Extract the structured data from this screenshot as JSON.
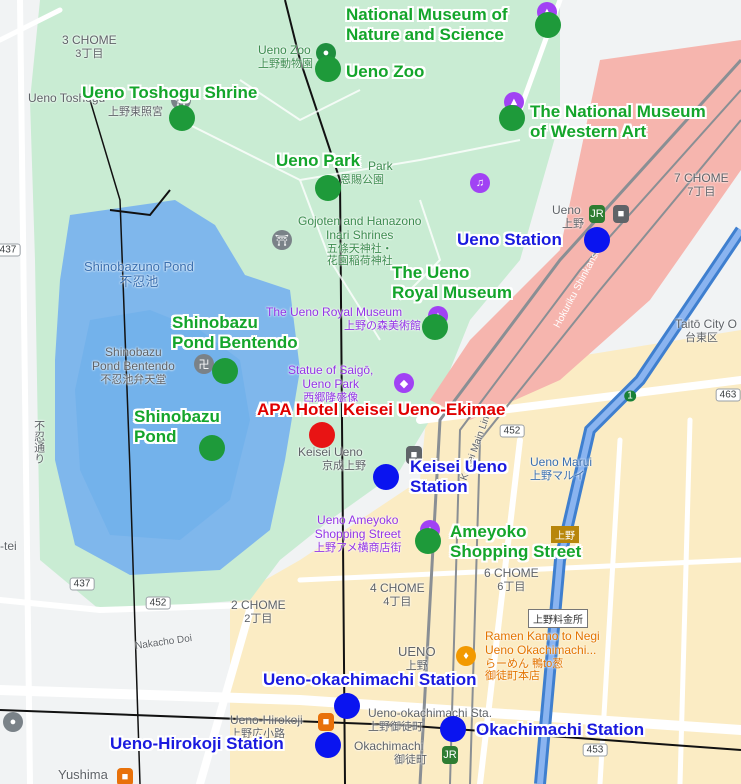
{
  "map": {
    "base_labels": {
      "chome3": {
        "text": "3 CHOME",
        "jp": "3丁目"
      },
      "ueno_zoo_small": {
        "text": "Ueno Zoo",
        "jp": "上野動物園"
      },
      "ueno_toshogu_small": {
        "text": "Ueno Toshogu",
        "jp": "上野東照宮"
      },
      "park_small": {
        "text": "Park",
        "jp": "恩賜公園"
      },
      "gojoten": {
        "text": "Gojoten and Hanazono",
        "text2": "Inari Shrines",
        "jp": "五條天神社・",
        "jp2": "花園稲荷神社"
      },
      "shinobazuno_pond": {
        "text": "Shinobazuno Pond",
        "jp": "不忍池"
      },
      "shinobazu_bentendo_small": {
        "text": "Shinobazu",
        "text2": "Pond Bentendo",
        "jp": "不忍池弁天堂"
      },
      "royal_museum_small": {
        "text": "The Ueno Royal Museum",
        "jp": "上野の森美術館"
      },
      "saigo": {
        "text": "Statue of Saigō,",
        "text2": "Ueno Park",
        "jp": "西郷隆盛像"
      },
      "keisei_ueno_small": {
        "text": "Keisei Ueno",
        "jp": "京成上野"
      },
      "ueno_marui": {
        "text": "Ueno Marui",
        "jp": "上野マルイ"
      },
      "ameyoko_small": {
        "text": "Ueno Ameyoko",
        "text2": "Shopping Street",
        "jp": "上野アメ横商店街"
      },
      "chome4": {
        "text": "4 CHOME",
        "jp": "4丁目"
      },
      "chome6": {
        "text": "6 CHOME",
        "jp": "6丁目"
      },
      "chome2": {
        "text": "2 CHOME",
        "jp": "2丁目"
      },
      "chome7": {
        "text": "7 CHOME",
        "jp": "7丁目"
      },
      "ueno_area": {
        "text": "UENO",
        "jp": "上野"
      },
      "ramen": {
        "text": "Ramen Kamo to Negi",
        "text2": "Ueno Okachimachi...",
        "jp": "らーめん 鴨to葱",
        "jp2": "御徒町本店"
      },
      "ueno_hirokoji_small": {
        "text": "Ueno-Hirokoji",
        "jp": "上野広小路"
      },
      "okachimachi_small": {
        "text": "Okachimachi",
        "jp": "御徒町"
      },
      "ueno_okachimachi_sta": {
        "text": "Ueno-okachimachi Sta.",
        "jp": "上野御徒町"
      },
      "ueno_station_small": {
        "text": "Ueno",
        "jp": "上野"
      },
      "taito_city": {
        "text": "Taitō City O",
        "jp": "台東区"
      },
      "yushima": {
        "text": "Yushima"
      },
      "nakacho_doi": {
        "text": "Nakacho Doi"
      },
      "shinobazu_dori": {
        "text": "不忍通り"
      },
      "hokuriku": {
        "text": "Hokuriku Shinkansen"
      },
      "tei": {
        "text": "-tei"
      },
      "keihin": {
        "text": "Keisei Main Line"
      },
      "ueno_price_sign": {
        "text": "上野料金所"
      },
      "ueno_sign": {
        "text": "上野"
      }
    },
    "route_shields": [
      "437",
      "437",
      "452",
      "452",
      "463",
      "453",
      "1"
    ],
    "markers": [
      {
        "name": "National Museum of Nature and Science",
        "lines": [
          "National Museum of",
          "Nature and Science"
        ],
        "color": "green"
      },
      {
        "name": "Ueno Zoo",
        "lines": [
          "Ueno Zoo"
        ],
        "color": "green"
      },
      {
        "name": "Ueno Toshogu Shrine",
        "lines": [
          "Ueno Toshogu Shrine"
        ],
        "color": "green"
      },
      {
        "name": "The National Museum of Western Art",
        "lines": [
          "The National Museum",
          "of Western Art"
        ],
        "color": "green"
      },
      {
        "name": "Ueno Park",
        "lines": [
          "Ueno Park"
        ],
        "color": "green"
      },
      {
        "name": "Ueno Station",
        "lines": [
          "Ueno Station"
        ],
        "color": "blue"
      },
      {
        "name": "The Ueno Royal Museum",
        "lines": [
          "The Ueno",
          "Royal Museum"
        ],
        "color": "green"
      },
      {
        "name": "Shinobazu Pond Bentendo",
        "lines": [
          "Shinobazu",
          "Pond Bentendo"
        ],
        "color": "green"
      },
      {
        "name": "APA Hotel Keisei Ueno-Ekimae",
        "lines": [
          "APA Hotel Keisei Ueno-Ekimae"
        ],
        "color": "red"
      },
      {
        "name": "Shinobazu Pond",
        "lines": [
          "Shinobazu",
          "Pond"
        ],
        "color": "green"
      },
      {
        "name": "Keisei Ueno Station",
        "lines": [
          "Keisei Ueno",
          "Station"
        ],
        "color": "blue"
      },
      {
        "name": "Ameyoko Shopping Street",
        "lines": [
          "Ameyoko",
          "Shopping Street"
        ],
        "color": "green"
      },
      {
        "name": "Ueno-okachimachi Station",
        "lines": [
          "Ueno-okachimachi Station"
        ],
        "color": "blue"
      },
      {
        "name": "Okachimachi Station",
        "lines": [
          "Okachimachi Station"
        ],
        "color": "blue"
      },
      {
        "name": "Ueno-Hirokoji Station",
        "lines": [
          "Ueno-Hirokoji Station"
        ],
        "color": "blue"
      }
    ],
    "colors": {
      "park": "#c9ecd3",
      "water": "#7fb7ec",
      "rail_zone": "#f6b5ae",
      "urban": "#fbecc4",
      "road": "#ffffff",
      "base": "#f1f3f4",
      "marker_green": "#1e9a3a",
      "marker_blue": "#0a14f0",
      "marker_red": "#e81414"
    }
  }
}
